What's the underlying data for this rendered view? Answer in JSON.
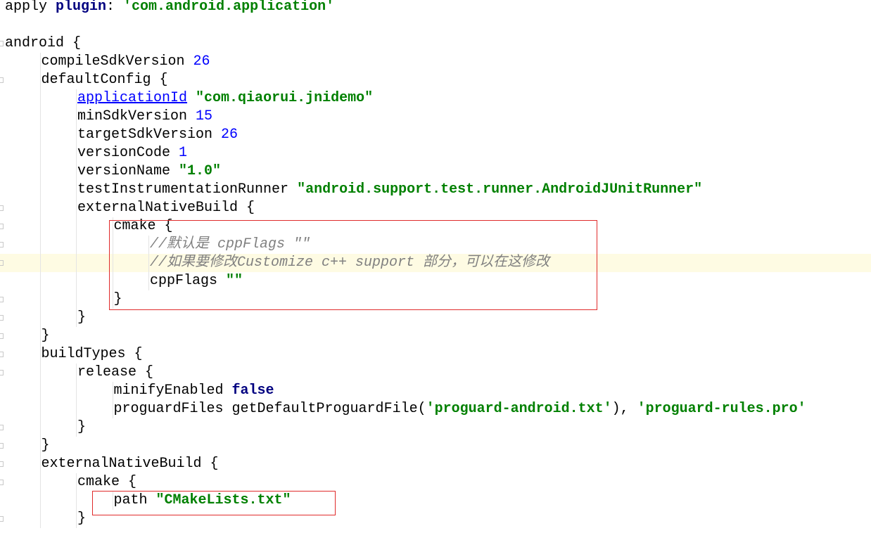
{
  "editor": {
    "lines": [
      {
        "indent": 0,
        "tokens": [
          {
            "t": "plain",
            "v": "apply "
          },
          {
            "t": "kw",
            "v": "plugin"
          },
          {
            "t": "plain",
            "v": ": "
          },
          {
            "t": "str",
            "v": "'com.android.application'"
          }
        ]
      },
      {
        "indent": 0,
        "tokens": []
      },
      {
        "indent": 0,
        "fold": true,
        "tokens": [
          {
            "t": "plain",
            "v": "android {"
          }
        ]
      },
      {
        "indent": 1,
        "tokens": [
          {
            "t": "plain",
            "v": "compileSdkVersion "
          },
          {
            "t": "num",
            "v": "26"
          }
        ]
      },
      {
        "indent": 1,
        "fold": true,
        "tokens": [
          {
            "t": "plain",
            "v": "defaultConfig {"
          }
        ]
      },
      {
        "indent": 2,
        "tokens": [
          {
            "t": "link",
            "v": "applicationId"
          },
          {
            "t": "plain",
            "v": " "
          },
          {
            "t": "str",
            "v": "\"com.qiaorui.jnidemo\""
          }
        ]
      },
      {
        "indent": 2,
        "tokens": [
          {
            "t": "plain",
            "v": "minSdkVersion "
          },
          {
            "t": "num",
            "v": "15"
          }
        ]
      },
      {
        "indent": 2,
        "tokens": [
          {
            "t": "plain",
            "v": "targetSdkVersion "
          },
          {
            "t": "num",
            "v": "26"
          }
        ]
      },
      {
        "indent": 2,
        "tokens": [
          {
            "t": "plain",
            "v": "versionCode "
          },
          {
            "t": "num",
            "v": "1"
          }
        ]
      },
      {
        "indent": 2,
        "tokens": [
          {
            "t": "plain",
            "v": "versionName "
          },
          {
            "t": "str",
            "v": "\"1.0\""
          }
        ]
      },
      {
        "indent": 2,
        "tokens": [
          {
            "t": "plain",
            "v": "testInstrumentationRunner "
          },
          {
            "t": "str",
            "v": "\"android.support.test.runner.AndroidJUnitRunner\""
          }
        ]
      },
      {
        "indent": 2,
        "fold": true,
        "tokens": [
          {
            "t": "plain",
            "v": "externalNativeBuild {"
          }
        ]
      },
      {
        "indent": 3,
        "fold": true,
        "tokens": [
          {
            "t": "plain",
            "v": "cmake {"
          }
        ]
      },
      {
        "indent": 4,
        "fold": true,
        "tokens": [
          {
            "t": "cm",
            "v": "//默认是 cppFlags \"\""
          }
        ]
      },
      {
        "indent": 4,
        "fold": true,
        "highlight": true,
        "tokens": [
          {
            "t": "cm",
            "v": "//如果要修改Customize c++ support 部分，可以在这修改"
          }
        ]
      },
      {
        "indent": 4,
        "tokens": [
          {
            "t": "plain",
            "v": "cppFlags "
          },
          {
            "t": "str",
            "v": "\"\""
          }
        ]
      },
      {
        "indent": 3,
        "fold": true,
        "tokens": [
          {
            "t": "plain",
            "v": "}"
          }
        ]
      },
      {
        "indent": 2,
        "fold": true,
        "tokens": [
          {
            "t": "plain",
            "v": "}"
          }
        ]
      },
      {
        "indent": 1,
        "fold": true,
        "tokens": [
          {
            "t": "plain",
            "v": "}"
          }
        ]
      },
      {
        "indent": 1,
        "fold": true,
        "tokens": [
          {
            "t": "plain",
            "v": "buildTypes {"
          }
        ]
      },
      {
        "indent": 2,
        "fold": true,
        "tokens": [
          {
            "t": "plain",
            "v": "release {"
          }
        ]
      },
      {
        "indent": 3,
        "tokens": [
          {
            "t": "plain",
            "v": "minifyEnabled "
          },
          {
            "t": "kw",
            "v": "false"
          }
        ]
      },
      {
        "indent": 3,
        "tokens": [
          {
            "t": "plain",
            "v": "proguardFiles getDefaultProguardFile("
          },
          {
            "t": "str",
            "v": "'proguard-android.txt'"
          },
          {
            "t": "plain",
            "v": "), "
          },
          {
            "t": "str",
            "v": "'proguard-rules.pro'"
          }
        ]
      },
      {
        "indent": 2,
        "fold": true,
        "tokens": [
          {
            "t": "plain",
            "v": "}"
          }
        ]
      },
      {
        "indent": 1,
        "fold": true,
        "tokens": [
          {
            "t": "plain",
            "v": "}"
          }
        ]
      },
      {
        "indent": 1,
        "fold": true,
        "tokens": [
          {
            "t": "plain",
            "v": "externalNativeBuild {"
          }
        ]
      },
      {
        "indent": 2,
        "fold": true,
        "tokens": [
          {
            "t": "plain",
            "v": "cmake {"
          }
        ]
      },
      {
        "indent": 3,
        "tokens": [
          {
            "t": "plain",
            "v": "path "
          },
          {
            "t": "str",
            "v": "\"CMakeLists.txt\""
          }
        ]
      },
      {
        "indent": 2,
        "fold": true,
        "tokens": [
          {
            "t": "plain",
            "v": "}"
          }
        ]
      }
    ]
  },
  "colors": {
    "keyword": "#000080",
    "string": "#008000",
    "number": "#0000ff",
    "comment": "#808080",
    "annotation_box": "#e02b2b",
    "current_line": "#fefbe3"
  }
}
